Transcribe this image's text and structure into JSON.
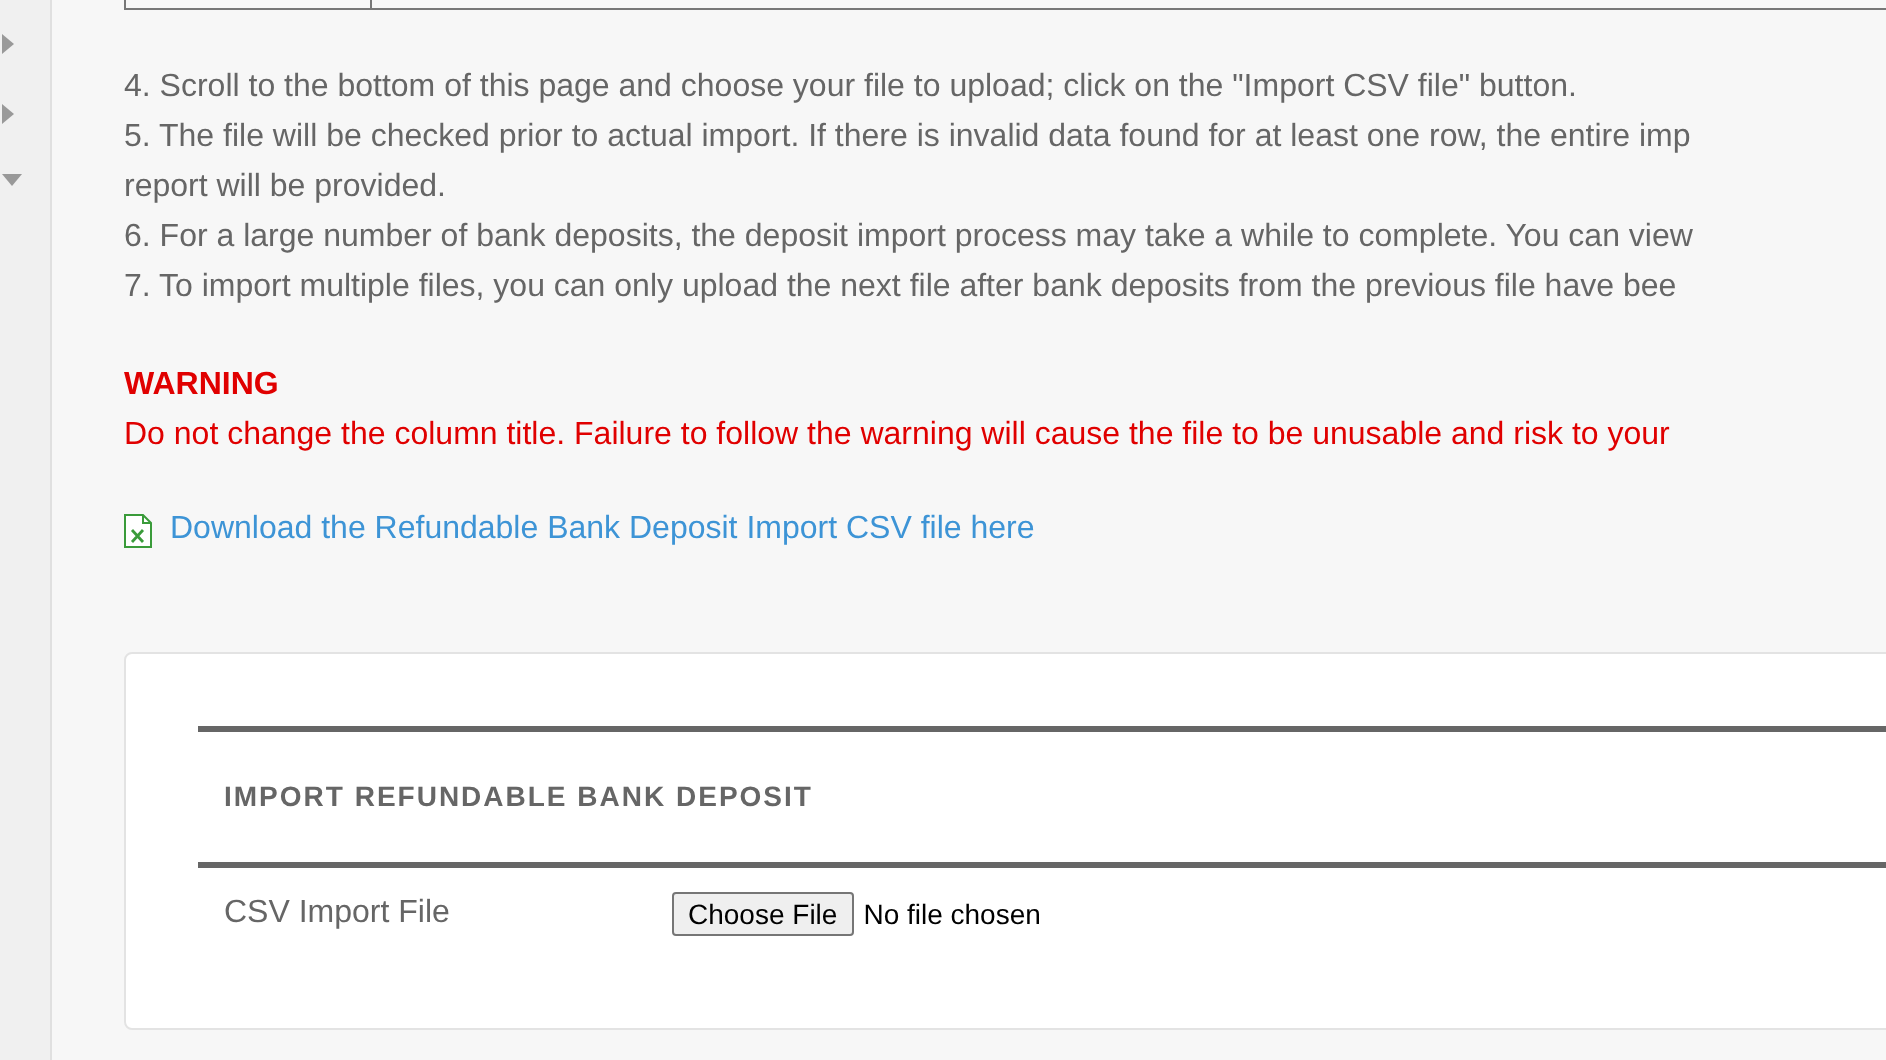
{
  "sidebar": {
    "items": [
      {
        "kind": "collapsed"
      },
      {
        "kind": "collapsed"
      },
      {
        "kind": "expanded"
      }
    ]
  },
  "instructions": [
    "4. Scroll to the bottom of this page and choose your file to upload; click on the \"Import CSV file\" button.",
    "5. The file will be checked prior to actual import. If there is invalid data found for at least one row, the entire imp",
    "report will be provided.",
    "6. For a large number of bank deposits, the deposit import process may take a while to complete. You can view",
    "7. To import multiple files, you can only upload the next file after bank deposits from the previous file have bee"
  ],
  "warning": {
    "title": "WARNING",
    "text": "Do not change the column title. Failure to follow the warning will cause the file to be unusable and risk to your"
  },
  "download_link": "Download the Refundable Bank Deposit Import CSV file here",
  "import_section": {
    "heading": "IMPORT REFUNDABLE BANK DEPOSIT",
    "field_label": "CSV Import File",
    "button": "Choose File",
    "file_status": "No file chosen"
  }
}
